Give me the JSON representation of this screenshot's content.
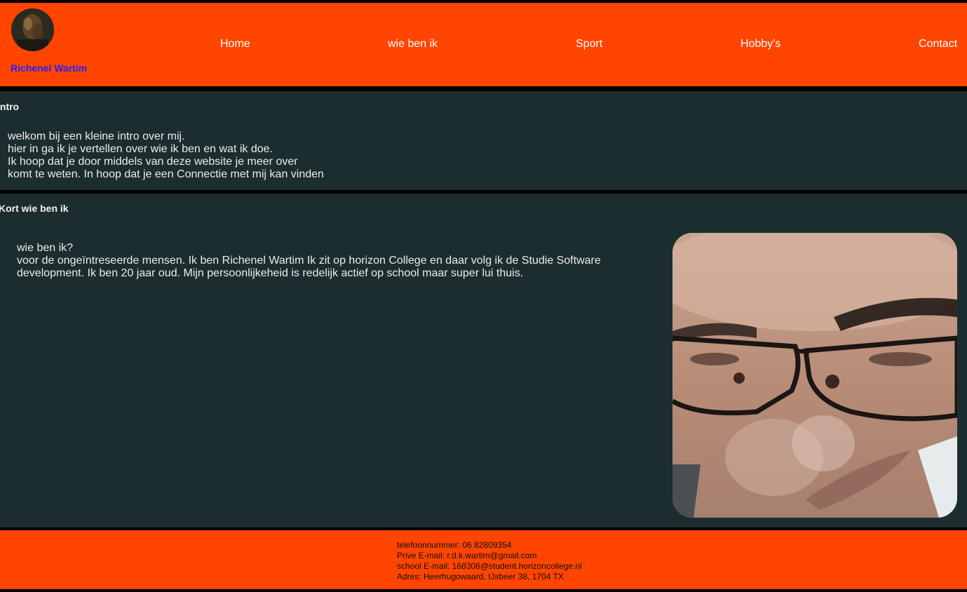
{
  "header": {
    "site_name": "Richenel Wartim",
    "nav": [
      {
        "label": "Home"
      },
      {
        "label": "wie ben ik"
      },
      {
        "label": "Sport"
      },
      {
        "label": "Hobby's"
      },
      {
        "label": "Contact"
      }
    ]
  },
  "intro": {
    "title": "Intro",
    "lines": [
      "welkom bij een kleine intro over mij.",
      "hier in ga ik je vertellen over wie ik ben en wat ik doe.",
      "Ik hoop dat je door middels van deze website je meer over",
      "komt te weten. In hoop dat je een Connectie met mij kan vinden"
    ]
  },
  "about": {
    "title": "Kort wie ben ik",
    "lines": [
      "wie ben ik?",
      "voor de ongeïntreseerde mensen. Ik ben Richenel Wartim Ik zit op horizon College en daar volg ik de Studie Software",
      "development. Ik ben 20 jaar oud. Mijn persoonlijkeheid is redelijk actief op school maar super lui thuis."
    ]
  },
  "footer": {
    "lines": [
      "telefoonnummer: 06 82809354",
      "Prive E-mail: r.d.k.wartim@gmail.com",
      "school E-mail: 168308@student.horizoncollege.nl",
      "Adres: Heerhugowaard, IJsbeer 38, 1704 TX"
    ]
  },
  "colors": {
    "accent": "#ff4500",
    "section_bg": "#1c2d2f",
    "divider": "#000000",
    "site_name": "#1f1fff"
  }
}
